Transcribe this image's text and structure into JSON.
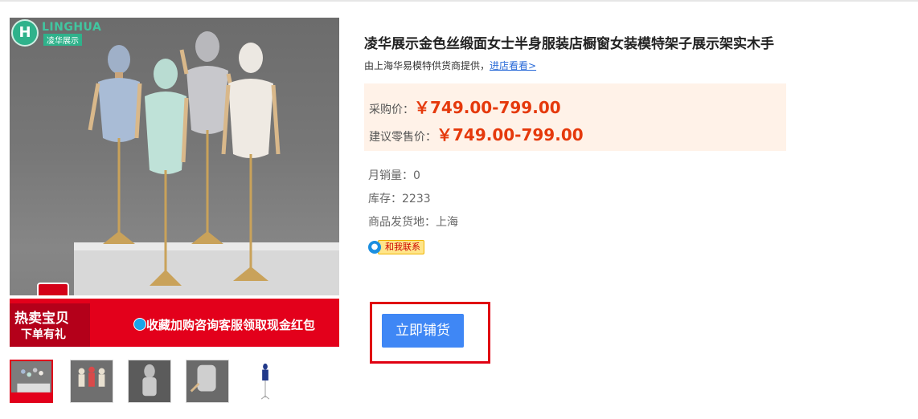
{
  "brand": {
    "logo_text": "LINGHUA",
    "logo_subtext": "凌华展示",
    "logo_mark": "H"
  },
  "main_image": {
    "banner_tag_line1": "热卖宝贝",
    "banner_tag_line2": "下单有礼",
    "banner_text": "收藏加购咨询客服领取现金红包"
  },
  "product": {
    "title": "凌华展示金色丝缎面女士半身服装店橱窗女装模特架子展示架实木手",
    "supplier_prefix": "由上海华易模特供货商提供，",
    "supplier_link": "进店看看>"
  },
  "prices": {
    "purchase_label": "采购价：",
    "purchase_value": "￥749.00-799.00",
    "retail_label": "建议零售价：",
    "retail_value": "￥749.00-799.00"
  },
  "meta": {
    "monthly_sales": "月销量：0",
    "stock": "库存：2233",
    "ship_from": "商品发货地：上海"
  },
  "contact": {
    "label": "和我联系",
    "icon": "chat-bubble-icon"
  },
  "actions": {
    "distribute_label": "立即铺货"
  },
  "colors": {
    "price_red": "#e5390c",
    "button_blue": "#3f87f5",
    "highlight_red": "#e00012",
    "price_bg": "#fff2e8"
  }
}
